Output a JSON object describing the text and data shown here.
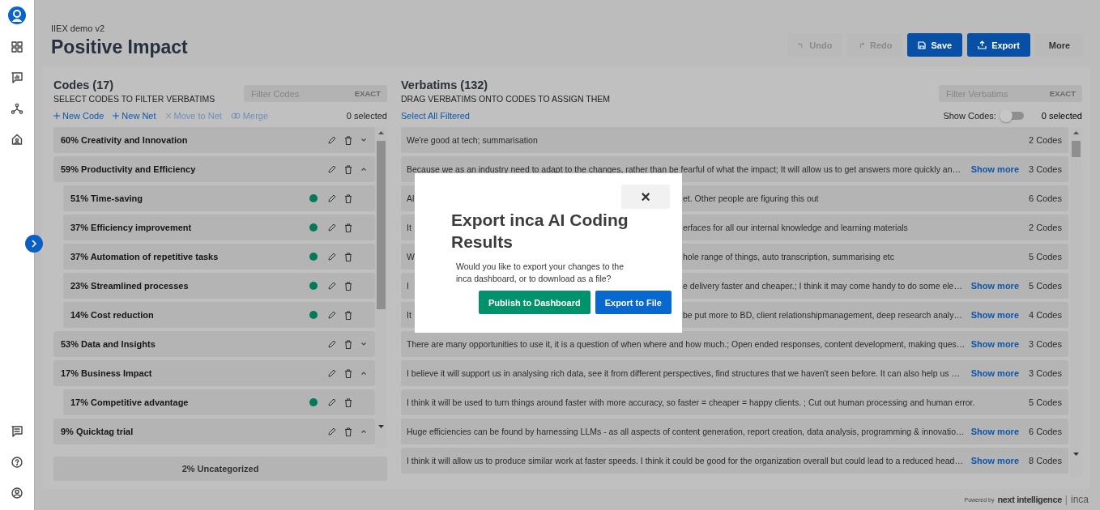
{
  "header": {
    "project": "IIEX demo v2",
    "title": "Positive Impact",
    "buttons": [
      {
        "label": "Undo",
        "kind": "undo",
        "disabled": true
      },
      {
        "label": "Redo",
        "kind": "redo",
        "disabled": true
      },
      {
        "label": "Save",
        "kind": "save",
        "disabled": false
      },
      {
        "label": "Export",
        "kind": "export",
        "disabled": false
      },
      {
        "label": "More",
        "kind": "plain",
        "disabled": false
      }
    ]
  },
  "codes": {
    "title": "Codes (17)",
    "subtitle": "SELECT CODES TO FILTER VERBATIMS",
    "filter": {
      "placeholder": "Filter Codes",
      "option": "EXACT"
    },
    "actions": [
      {
        "label": "New Code",
        "kind": "plus",
        "disabled": false
      },
      {
        "label": "New Net",
        "kind": "plus",
        "disabled": false
      },
      {
        "label": "Move to Net",
        "kind": "move",
        "disabled": true
      },
      {
        "label": "Merge",
        "kind": "merge",
        "disabled": true
      }
    ],
    "selected_count": "0 selected",
    "items": [
      {
        "label": "60% Creativity and Innovation",
        "expanded": false
      },
      {
        "label": "59% Productivity and Efficiency",
        "expanded": true,
        "children": [
          {
            "label": "51% Time-saving",
            "color": "#007a5a"
          },
          {
            "label": "37% Efficiency improvement",
            "color": "#007a5a"
          },
          {
            "label": "37% Automation of repetitive tasks",
            "color": "#007a5a"
          },
          {
            "label": "23% Streamlined processes",
            "color": "#007a5a"
          },
          {
            "label": "14% Cost reduction",
            "color": "#007a5a"
          }
        ]
      },
      {
        "label": "53% Data and Insights",
        "expanded": false
      },
      {
        "label": "17% Business Impact",
        "expanded": true,
        "children": [
          {
            "label": "17% Competitive advantage",
            "color": "#007a5a"
          }
        ]
      },
      {
        "label": "9% Quicktag trial",
        "expanded": true
      }
    ],
    "uncategorized": "2% Uncategorized"
  },
  "verbatims": {
    "title": "Verbatims (132)",
    "subtitle": "DRAG VERBATIMS ONTO CODES TO ASSIGN THEM",
    "filter": {
      "placeholder": "Filter Verbatims",
      "option": "EXACT"
    },
    "select_all": "Select All Filtered",
    "show_codes": {
      "label": "Show Codes:",
      "on": false
    },
    "selected_count": "0 selected",
    "rows": [
      {
        "text": "We're good at tech; summarisation",
        "codes": "2 Codes"
      },
      {
        "text": "Because we as an industry need to adapt to the changes, rather than be fearful of what the impact; It will allow us to get answers more quickly an…",
        "show_more": "Show more",
        "codes": "3 Codes"
      },
      {
        "start": "Al",
        "end": "et. Other people are figuring this out",
        "codes": "6 Codes"
      },
      {
        "start": "It",
        "end": "erfaces for all our internal knowledge and learning materials",
        "codes": "2 Codes"
      },
      {
        "start": "W",
        "end": "hole range of things, auto transcription, summarising etc",
        "codes": "5 Codes"
      },
      {
        "start": "I",
        "end": "e delivery faster and cheaper.; I think it may come handy to do some ele…",
        "show_more": "Show more",
        "codes": "5 Codes"
      },
      {
        "start": "It",
        "end": "be put more to BD, client relationshipmanagement, deep research analy…",
        "show_more": "Show more",
        "codes": "4 Codes"
      },
      {
        "text": "There are many opportunities to use it, it is a question of when where and how much.; Open ended responses, content development, making ques…",
        "show_more": "Show more",
        "codes": "3 Codes"
      },
      {
        "text": "I believe it will support us in analysing rich data, see it from different perspectives, find structures that we haven't seen before. It can also help us …",
        "show_more": "Show more",
        "codes": "3 Codes"
      },
      {
        "text": "I think it will be used to turn things around faster with more accuracy, so faster = cheaper = happy clients. ; Cut out human processing and human error.",
        "codes": "5 Codes"
      },
      {
        "text": "Huge efficiencies can be found by harnessing LLMs - as all aspects of content generation, report creation, data analysis, programming & innovatio…",
        "show_more": "Show more",
        "codes": "6 Codes"
      },
      {
        "text": "I think it will allow us to produce similar work at faster speeds. I think it could be good for the organization overall but could lead to a reduced head…",
        "show_more": "Show more",
        "codes": "8 Codes"
      }
    ]
  },
  "dialog": {
    "title": "Export inca AI Coding Results",
    "message": "Would you like to export your changes to the inca dashboard, or to download as a file?",
    "close": "×",
    "buttons": [
      {
        "label": "Publish to Dashboard",
        "kind": "publish"
      },
      {
        "label": "Export to File",
        "kind": "file"
      }
    ]
  },
  "footer": {
    "powered": "Powered by",
    "brand": "next intelligence",
    "separator": "|",
    "product": "inca"
  }
}
